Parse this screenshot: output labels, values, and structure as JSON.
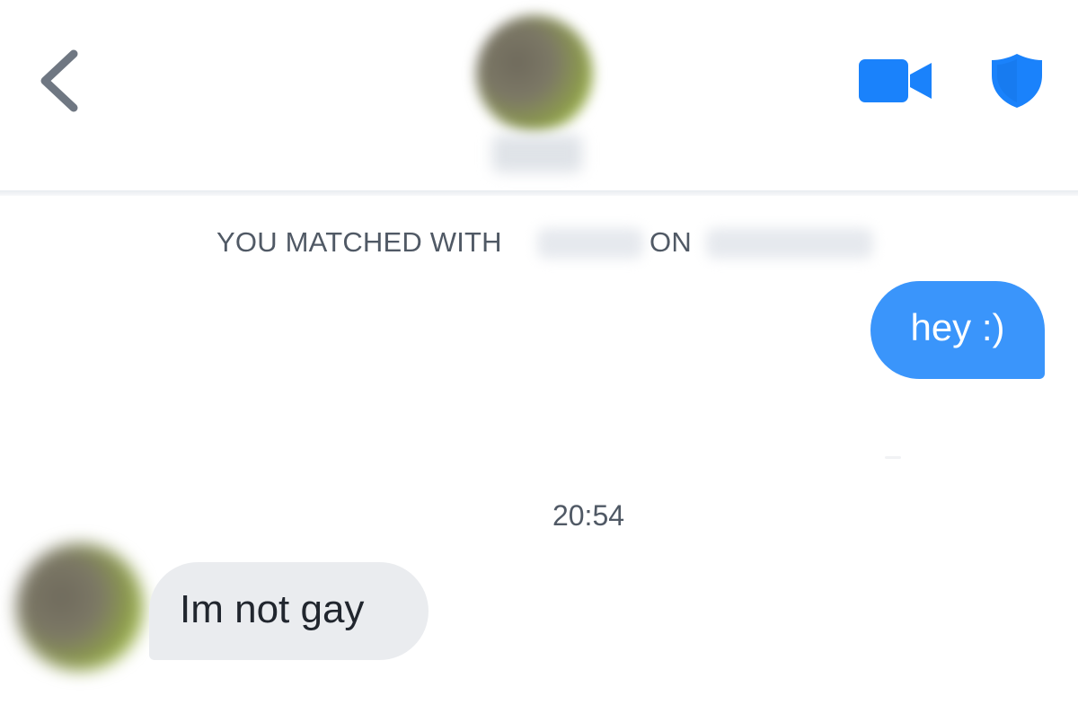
{
  "header": {
    "back_icon": "chevron-left-icon",
    "video_icon": "video-camera-icon",
    "shield_icon": "shield-icon",
    "accent_color": "#1a82fb",
    "back_color": "#6f7782"
  },
  "match_notice": {
    "prefix": "YOU MATCHED WITH",
    "middle": "ON"
  },
  "messages": [
    {
      "direction": "outgoing",
      "text": "hey :)",
      "color": "#3a95fb"
    },
    {
      "timestamp": "20:54"
    },
    {
      "direction": "incoming",
      "text": "Im not gay",
      "color": "#eaecef"
    }
  ]
}
